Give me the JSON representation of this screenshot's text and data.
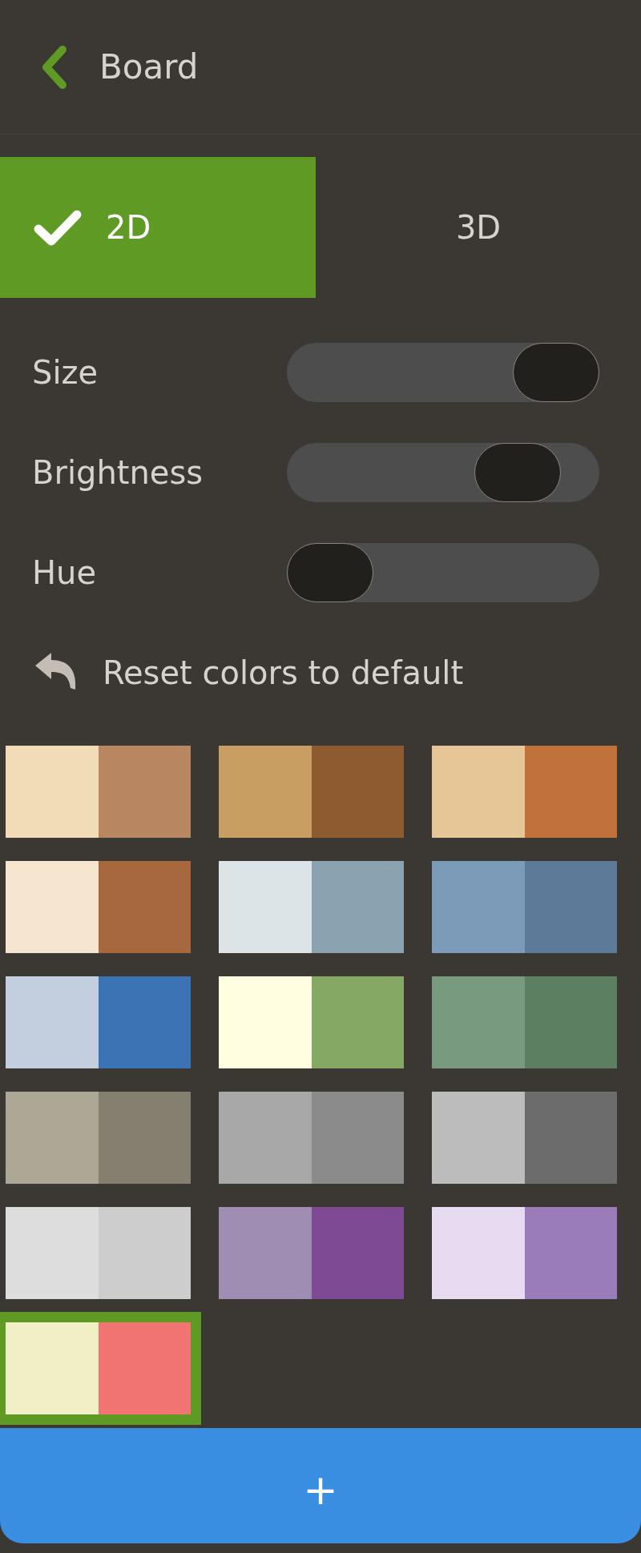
{
  "header": {
    "title": "Board"
  },
  "tabs": [
    {
      "label": "2D",
      "selected": true
    },
    {
      "label": "3D",
      "selected": false
    }
  ],
  "sliders": [
    {
      "label": "Size",
      "level": 1.0
    },
    {
      "label": "Brightness",
      "level": 0.83
    },
    {
      "label": "Hue",
      "level": 0.0
    }
  ],
  "reset": {
    "label": "Reset colors to default"
  },
  "swatches": [
    {
      "squares": [
        {
          "color": "#f2dcb8"
        },
        {
          "color": "#b88762"
        }
      ],
      "selected": false
    },
    {
      "squares": [
        {
          "color": "#c89e63"
        },
        {
          "color": "#8e5a30"
        }
      ],
      "selected": false
    },
    {
      "squares": [
        {
          "color": "#e6c596"
        },
        {
          "color": "#c1713a"
        }
      ],
      "selected": false
    },
    {
      "squares": [
        {
          "color": "#f6e6cf"
        },
        {
          "color": "#a7683e"
        }
      ],
      "selected": false
    },
    {
      "squares": [
        {
          "color": "#dde4e8"
        },
        {
          "color": "#8ba3b0"
        }
      ],
      "selected": false
    },
    {
      "squares": [
        {
          "color": "#7b9bb9"
        },
        {
          "color": "#5d7b98"
        }
      ],
      "selected": false
    },
    {
      "squares": [
        {
          "color": "#c3cfdf"
        },
        {
          "color": "#3c73b4"
        }
      ],
      "selected": false
    },
    {
      "squares": [
        {
          "color": "#fffee0"
        },
        {
          "color": "#85a964"
        }
      ],
      "selected": false
    },
    {
      "squares": [
        {
          "color": "#789a7e"
        },
        {
          "color": "#5c7f62"
        }
      ],
      "selected": false
    },
    {
      "squares": [
        {
          "color": "#ada795"
        },
        {
          "color": "#857f6f"
        }
      ],
      "selected": false
    },
    {
      "squares": [
        {
          "color": "#a8a8a8"
        },
        {
          "color": "#8b8b8b"
        }
      ],
      "selected": false
    },
    {
      "squares": [
        {
          "color": "#bcbcbc"
        },
        {
          "color": "#6c6c6c"
        }
      ],
      "selected": false
    },
    {
      "squares": [
        {
          "color": "#dddddd"
        },
        {
          "color": "#cdcdcd"
        }
      ],
      "selected": false
    },
    {
      "squares": [
        {
          "color": "#9f8db4"
        },
        {
          "color": "#7d4a93"
        }
      ],
      "selected": false
    },
    {
      "squares": [
        {
          "color": "#e7dbf1"
        },
        {
          "color": "#9b7cba"
        }
      ],
      "selected": false
    },
    {
      "squares": [
        {
          "color": "#f1efc6"
        },
        {
          "color": "#f27472"
        }
      ],
      "selected": true
    }
  ],
  "add_button": {
    "label": "+"
  }
}
